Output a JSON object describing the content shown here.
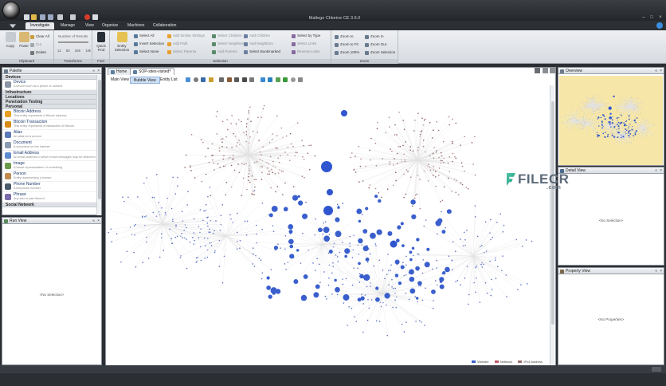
{
  "window": {
    "title": "Maltego Chlorine CE 3.6.0"
  },
  "menu": {
    "tabs": [
      "Investigate",
      "Manage",
      "View",
      "Organize",
      "Machines",
      "Collaboration"
    ],
    "active": "Investigate"
  },
  "ribbon": {
    "clipboard": {
      "label": "Clipboard",
      "copy": "Copy",
      "paste": "Paste",
      "clear_all": "Clear All",
      "cut": "Cut",
      "delete": "Delete"
    },
    "transforms": {
      "label": "Transforms",
      "number_of_results": "Number of Results",
      "values": [
        "12",
        "50",
        "255",
        "10k"
      ]
    },
    "find": {
      "label": "Find",
      "quick_find": "Quick Find"
    },
    "selection": {
      "label": "Selection",
      "entity_selection": "Entity Selection",
      "items": [
        {
          "t": "Select All",
          "d": false
        },
        {
          "t": "Add Similar Siblings",
          "d": true
        },
        {
          "t": "Select Children",
          "d": true
        },
        {
          "t": "Add Children",
          "d": true
        },
        {
          "t": "Select by Type",
          "d": false
        },
        {
          "t": "Invert Selection",
          "d": false
        },
        {
          "t": "Add Path",
          "d": true
        },
        {
          "t": "Select Neighbors",
          "d": true
        },
        {
          "t": "Add Neighbors",
          "d": true
        },
        {
          "t": "Select Links",
          "d": true
        },
        {
          "t": "Select None",
          "d": false
        },
        {
          "t": "Select Parents",
          "d": true
        },
        {
          "t": "Add Parents",
          "d": true
        },
        {
          "t": "Select Bookmarked",
          "d": false
        },
        {
          "t": "Reverse Links",
          "d": true
        }
      ]
    },
    "zoom": {
      "label": "Zoom",
      "items": [
        "Zoom to",
        "Zoom In",
        "Zoom to Fit",
        "Zoom Out",
        "Zoom 100%",
        "Zoom Selection"
      ]
    }
  },
  "palette": {
    "title": "Palette",
    "categories": {
      "devices": "Devices",
      "infrastructure": "Infrastructure",
      "locations": "Locations",
      "pentest": "Penetration Testing",
      "personal": "Personal",
      "social": "Social Network"
    },
    "device": {
      "name": "Device",
      "desc": "A device such as a phone or camera"
    },
    "entities": [
      {
        "name": "Bitcoin Address",
        "desc": "This entity represents a Bitcoin address.",
        "color": "#e8a020"
      },
      {
        "name": "Bitcoin Transaction",
        "desc": "This entity represents a transaction of Bitcoin.",
        "color": "#d88a18"
      },
      {
        "name": "Alias",
        "desc": "An alias for a person",
        "color": "#5a7ab8"
      },
      {
        "name": "Document",
        "desc": "A document on the Internet",
        "color": "#8a9aae"
      },
      {
        "name": "Email Address",
        "desc": "An email address to which email messages may be delivered",
        "color": "#5d8ad0"
      },
      {
        "name": "Image",
        "desc": "A visual representation of something",
        "color": "#6a9a4a"
      },
      {
        "name": "Person",
        "desc": "Entity representing a human",
        "color": "#c08a50"
      },
      {
        "name": "Phone Number",
        "desc": "A telephone number",
        "color": "#4a5a6a"
      },
      {
        "name": "Phrase",
        "desc": "Any text or part thereof",
        "color": "#7a6aa8"
      }
    ]
  },
  "run_view": {
    "title": "Run View",
    "empty": "<No Selection>"
  },
  "graph": {
    "tabs": [
      "Home",
      "SOP-sites-visited"
    ],
    "view_tabs": [
      "Main View",
      "Bubble View",
      "Entity List"
    ],
    "active_view": "Bubble View",
    "legend": [
      {
        "label": "Website",
        "color": "#3a5fcd"
      },
      {
        "label": "Netblock",
        "color": "#c05a6a"
      },
      {
        "label": "IPv4 Address",
        "color": "#9a7070"
      }
    ]
  },
  "overview": {
    "title": "Overview"
  },
  "detail_view": {
    "title": "Detail View",
    "empty": "<No Selection>"
  },
  "property_view": {
    "title": "Property View",
    "empty": "<No Properties>"
  },
  "watermark": {
    "brand": "FILECR",
    "domain": ".com"
  }
}
